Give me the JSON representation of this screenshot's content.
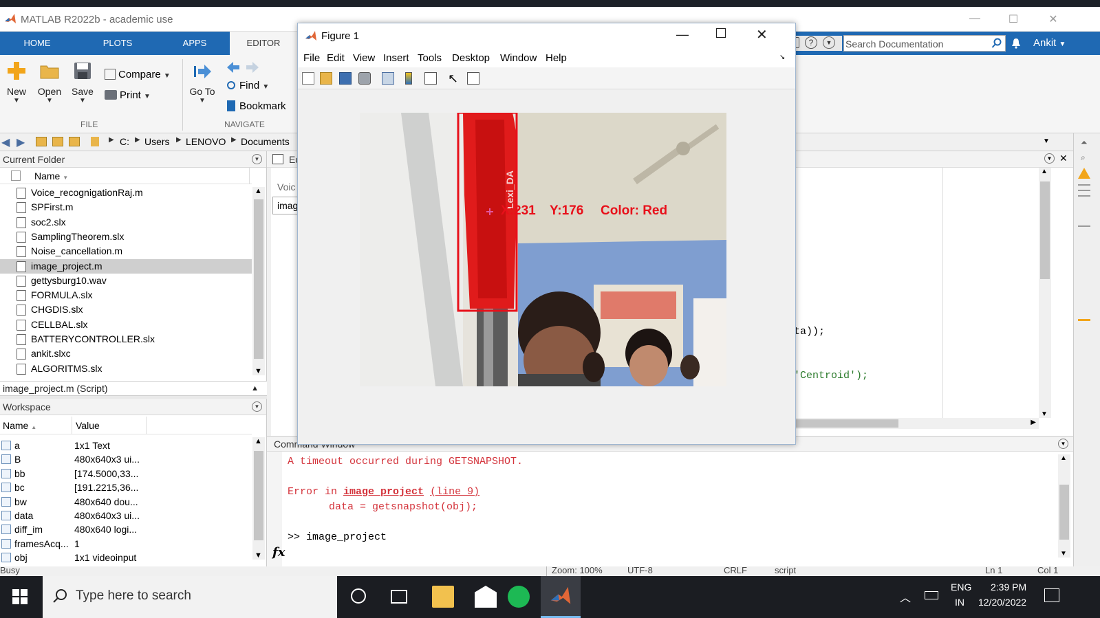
{
  "app": {
    "title": "MATLAB R2022b - academic use",
    "user": "Ankit",
    "search_placeholder": "Search Documentation"
  },
  "ribbon": {
    "tabs": [
      "HOME",
      "PLOTS",
      "APPS",
      "EDITOR"
    ],
    "active_tab": "EDITOR",
    "file_group": "FILE",
    "navigate_group": "NAVIGATE",
    "buttons": {
      "new": "New",
      "open": "Open",
      "save": "Save",
      "compare": "Compare",
      "print": "Print",
      "goto": "Go To",
      "find": "Find",
      "bookmark": "Bookmark"
    }
  },
  "address": {
    "crumbs": [
      "C:",
      "Users",
      "LENOVO",
      "Documents"
    ]
  },
  "current_folder": {
    "title": "Current Folder",
    "column": "Name",
    "files": [
      "Voice_recognigationRaj.m",
      "SPFirst.m",
      "soc2.slx",
      "SamplingTheorem.slx",
      "Noise_cancellation.m",
      "image_project.m",
      "gettysburg10.wav",
      "FORMULA.slx",
      "CHGDIS.slx",
      "CELLBAL.slx",
      "BATTERYCONTROLLER.slx",
      "ankit.slxc",
      "ALGORITMS.slx"
    ],
    "selected": "image_project.m",
    "details": "image_project.m  (Script)"
  },
  "workspace": {
    "title": "Workspace",
    "col_name": "Name",
    "col_value": "Value",
    "rows": [
      {
        "name": "a",
        "value": "1x1 Text"
      },
      {
        "name": "B",
        "value": "480x640x3 ui..."
      },
      {
        "name": "bb",
        "value": "[174.5000,33..."
      },
      {
        "name": "bc",
        "value": "[191.2215,36..."
      },
      {
        "name": "bw",
        "value": "480x640 dou..."
      },
      {
        "name": "data",
        "value": "480x640x3 ui..."
      },
      {
        "name": "diff_im",
        "value": "480x640 logi..."
      },
      {
        "name": "framesAcq...",
        "value": "1"
      },
      {
        "name": "obj",
        "value": "1x1 videoinput"
      }
    ]
  },
  "editor": {
    "tab_partial": "Ed",
    "label_partial": "Voic",
    "field_partial": "imag",
    "code_line1": "data));",
    "code_line2": ", 'Centroid');"
  },
  "command_window": {
    "title": "Command Window",
    "line1": "A timeout occurred during GETSNAPSHOT.",
    "error_prefix": "Error in ",
    "error_link": "image_project",
    "error_line": "(line 9)",
    "code": "data = getsnapshot(obj);",
    "prompt": ">> image_project",
    "fx": "fx"
  },
  "statusbar": {
    "busy": "Busy",
    "zoom": "Zoom: 100%",
    "encoding": "UTF-8",
    "eol": "CRLF",
    "type": "script",
    "ln": "Ln  1",
    "col": "Col  1"
  },
  "figure": {
    "title": "Figure 1",
    "menus": [
      "File",
      "Edit",
      "View",
      "Insert",
      "Tools",
      "Desktop",
      "Window",
      "Help"
    ],
    "overlay_x": "X:231",
    "overlay_y": "Y:176",
    "overlay_color": "Color: Red",
    "bottle_text": "Lexi_DA"
  },
  "taskbar": {
    "search_placeholder": "Type here to search",
    "lang1": "ENG",
    "lang2": "IN",
    "time": "2:39 PM",
    "date": "12/20/2022"
  },
  "colors": {
    "ribbon_blue": "#1f69b3",
    "error_red": "#d4343c",
    "overlay_red": "#e8101a",
    "spotify_green": "#1db954"
  }
}
